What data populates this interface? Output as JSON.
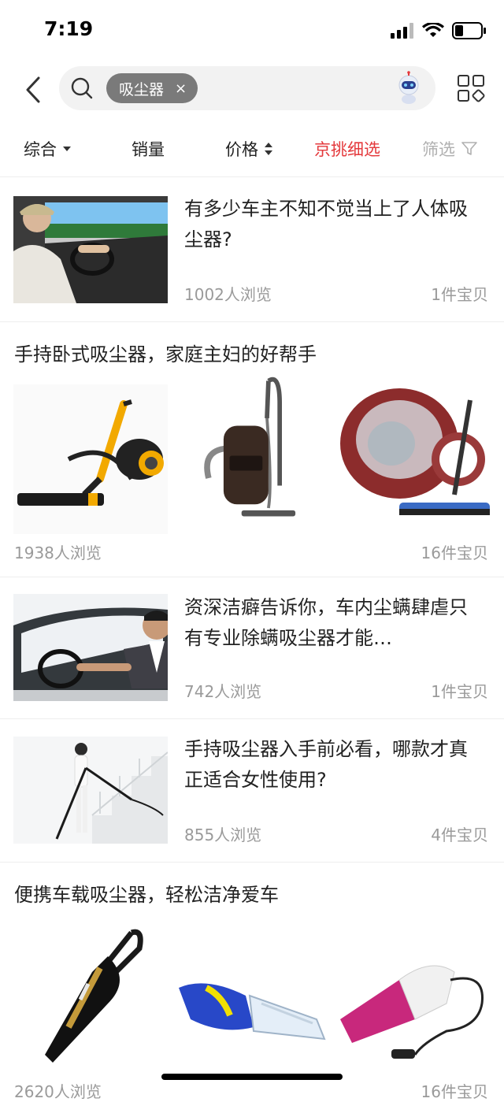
{
  "status_bar": {
    "time": "7:19"
  },
  "search": {
    "keyword": "吸尘器",
    "chip_close": "×"
  },
  "sort": {
    "items": [
      "综合",
      "销量",
      "价格",
      "京挑细选",
      "筛选"
    ]
  },
  "articles": [
    {
      "title": "有多少车主不知不觉当上了人体吸尘器?",
      "views": "1002人浏览",
      "count": "1件宝贝"
    },
    {
      "title": "手持卧式吸尘器，家庭主妇的好帮手",
      "views": "1938人浏览",
      "count": "16件宝贝"
    },
    {
      "title": "资深洁癖告诉你，车内尘螨肆虐只有专业除螨吸尘器才能…",
      "views": "742人浏览",
      "count": "1件宝贝"
    },
    {
      "title": "手持吸尘器入手前必看，哪款才真正适合女性使用?",
      "views": "855人浏览",
      "count": "4件宝贝"
    },
    {
      "title": "便携车载吸尘器，轻松洁净爱车",
      "views": "2620人浏览",
      "count": "16件宝贝"
    }
  ],
  "colors": {
    "accent": "#e4393c",
    "muted_text": "#9a9a9a",
    "chip_bg": "#7a7a7a"
  }
}
